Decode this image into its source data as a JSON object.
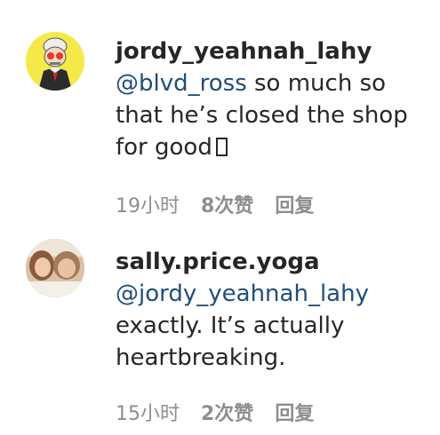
{
  "comments": [
    {
      "username": "jordy_yeahnah_lahy",
      "mention": "@blvd_ross",
      "text_after_mention": " so much so that he’s closed the shop for good",
      "time": "19小时",
      "likes": "8次赞",
      "reply_label": "回复",
      "avatar_icon": "cartoon-face-avatar"
    },
    {
      "username": "sally.price.yoga",
      "mention": "@jordy_yeahnah_lahy",
      "text_after_mention": "exactly. It’s actually heartbreaking.",
      "time": "15小时",
      "likes": "2次赞",
      "reply_label": "回复",
      "avatar_icon": "photo-avatar"
    }
  ],
  "colors": {
    "mention": "#1f4e79",
    "meta": "#8e8e8e",
    "text": "#262626"
  }
}
